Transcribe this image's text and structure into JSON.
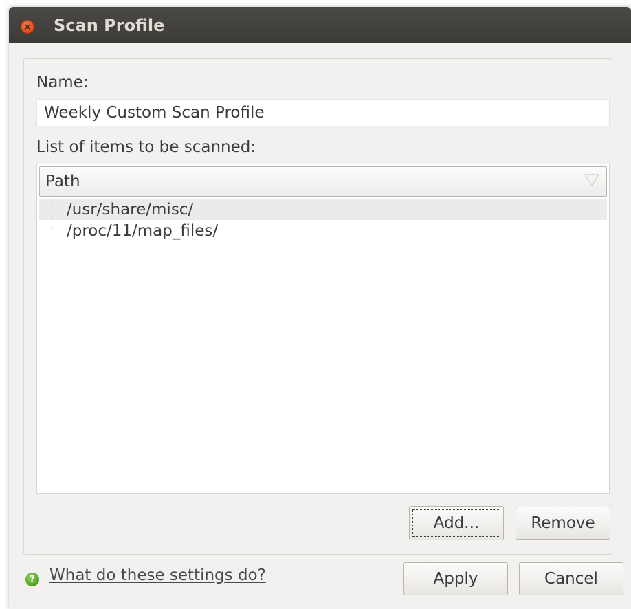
{
  "window": {
    "title": "Scan Profile",
    "close_glyph": "×"
  },
  "form": {
    "name_label": "Name:",
    "name_value": "Weekly Custom Scan Profile",
    "list_label": "List of items to be scanned:"
  },
  "list": {
    "column_header": "Path",
    "items": [
      {
        "path": "/usr/share/misc/",
        "selected": true
      },
      {
        "path": "/proc/11/map_files/",
        "selected": false
      }
    ]
  },
  "buttons": {
    "add": "Add...",
    "remove": "Remove",
    "apply": "Apply",
    "cancel": "Cancel"
  },
  "help": {
    "icon_glyph": "?",
    "link_text": "What do these settings do?"
  },
  "colors": {
    "titlebar": "#3c3b37",
    "close_button": "#df4a16",
    "window_bg": "#f2f1f0",
    "help_icon": "#4a9a1e"
  }
}
